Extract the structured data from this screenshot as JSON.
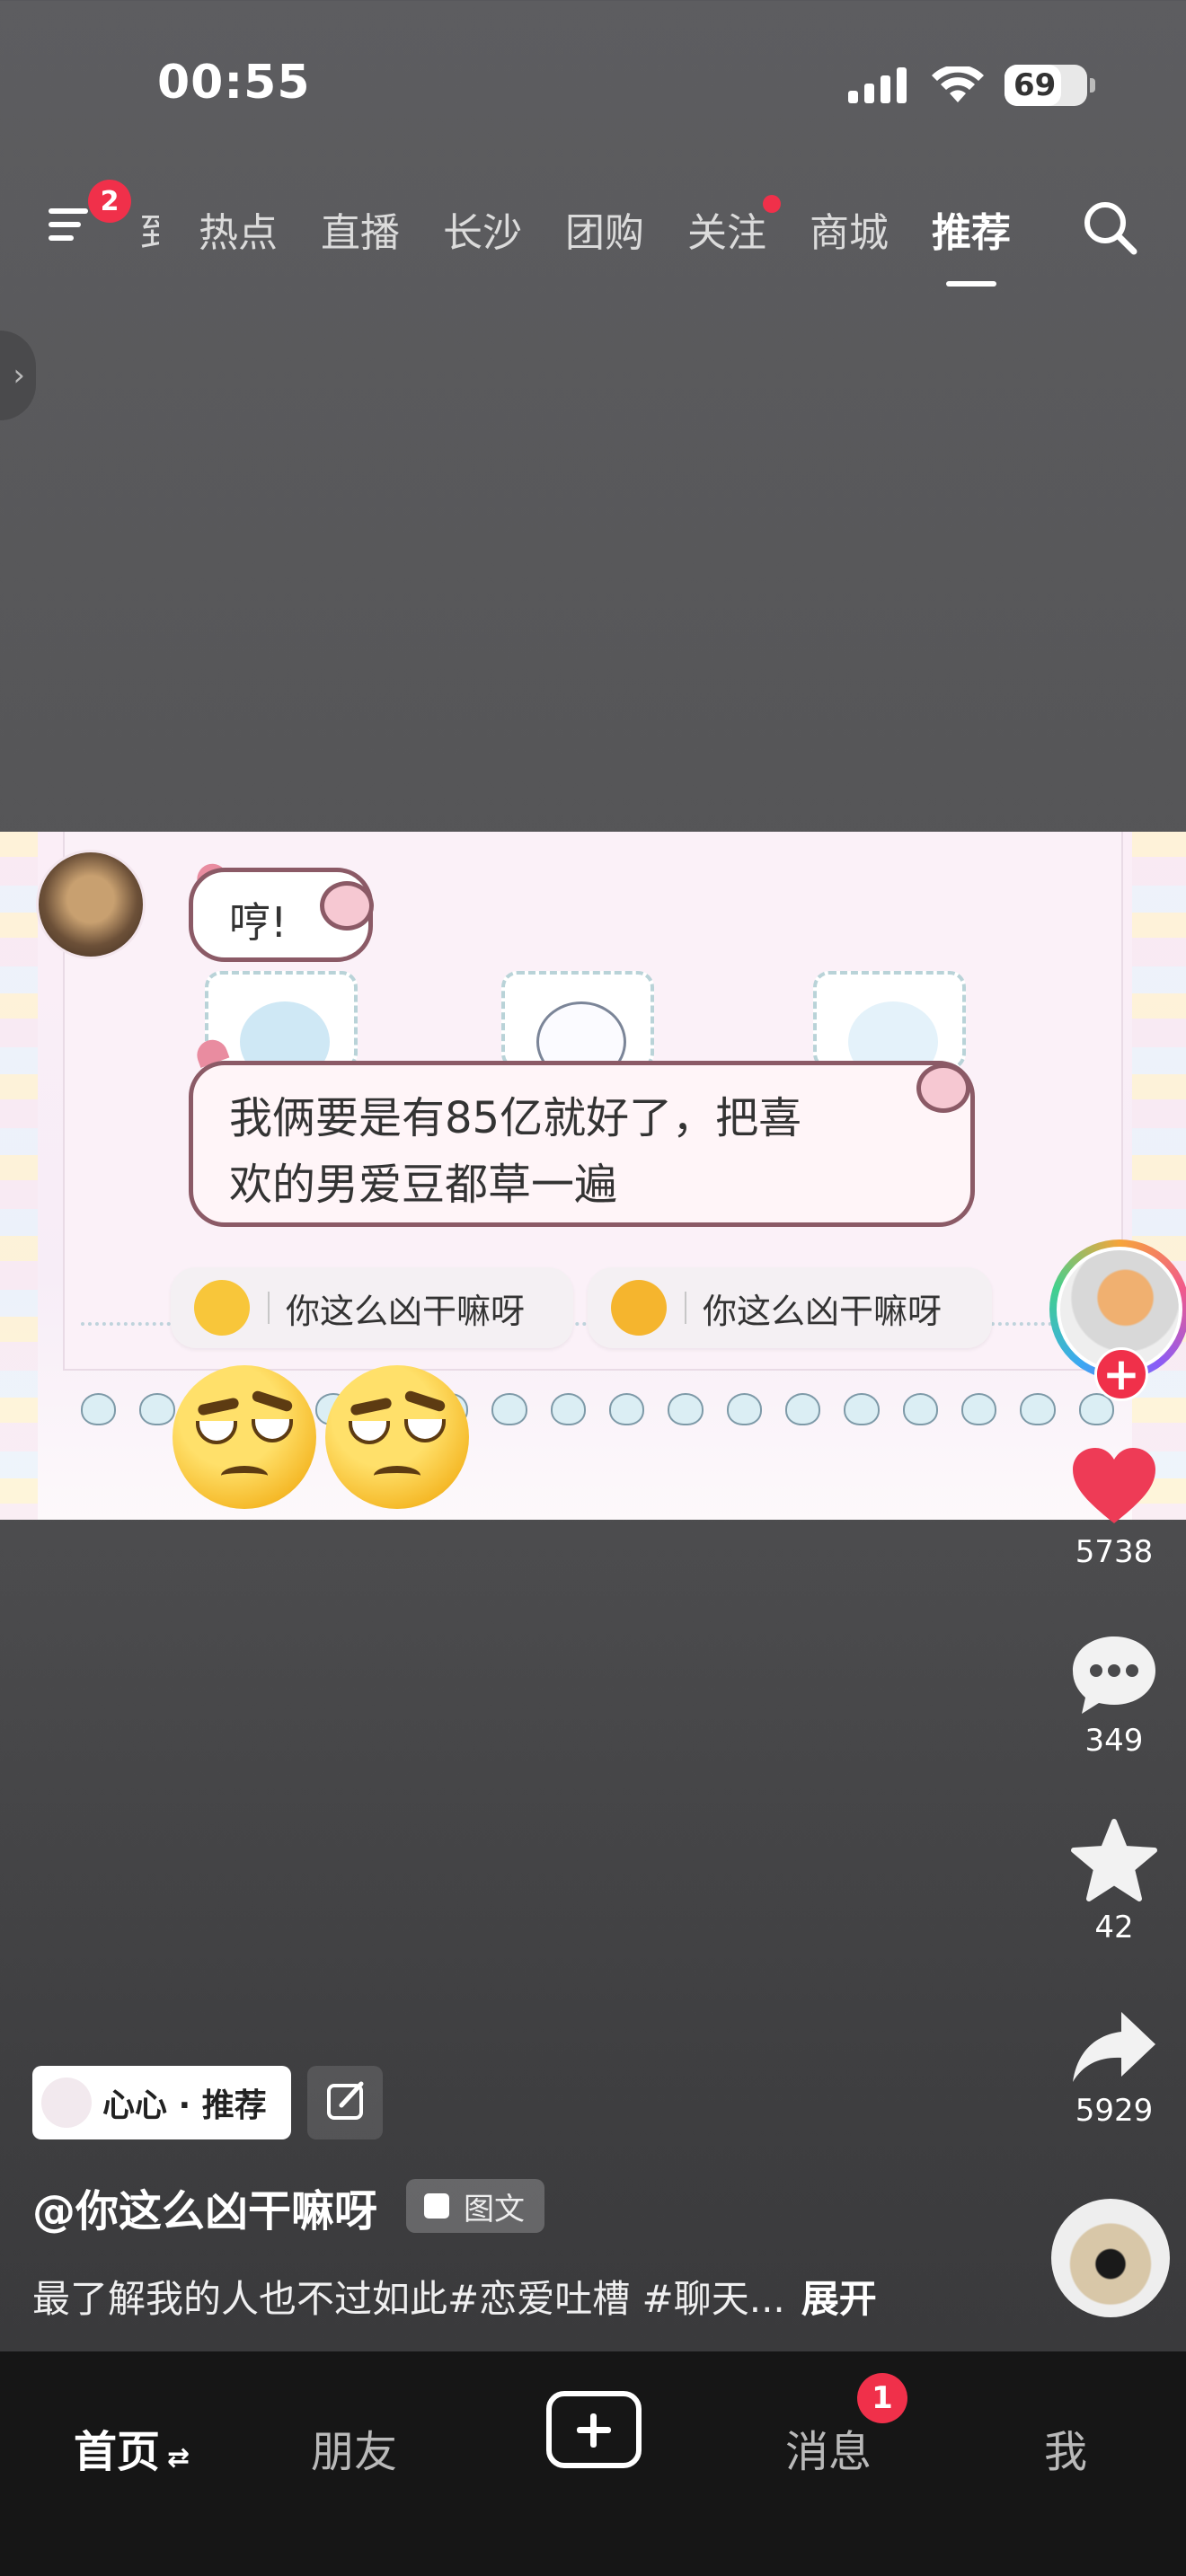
{
  "status_bar": {
    "time": "00:55",
    "battery_level": "69",
    "battery_fraction": 0.69
  },
  "top_nav": {
    "menu_badge": "2",
    "tabs": [
      {
        "label": "到"
      },
      {
        "label": "热点"
      },
      {
        "label": "直播"
      },
      {
        "label": "长沙"
      },
      {
        "label": "团购"
      },
      {
        "label": "关注"
      },
      {
        "label": "商城"
      },
      {
        "label": "推荐"
      }
    ],
    "active_tab": "推荐"
  },
  "post": {
    "image": {
      "bubble_1": "哼!",
      "bubble_2_line1": "我俩要是有85亿就好了，把喜",
      "bubble_2_line2": "欢的男爱豆都草一遍",
      "chip_1": "你这么凶干嘛呀",
      "chip_2": "你这么凶干嘛呀"
    },
    "tag_pill": "心心 · 推荐",
    "author": "@你这么凶干嘛呀",
    "type_badge": "图文",
    "description": "最了解我的人也不过如此#恋爱吐槽 #聊天...",
    "expand": "展开"
  },
  "actions": {
    "likes": "5738",
    "comments": "349",
    "favorites": "42",
    "shares": "5929",
    "like_color": "#ee3b56"
  },
  "tab_bar": {
    "home": "首页",
    "friends": "朋友",
    "messages": "消息",
    "messages_badge": "1",
    "me": "我"
  }
}
